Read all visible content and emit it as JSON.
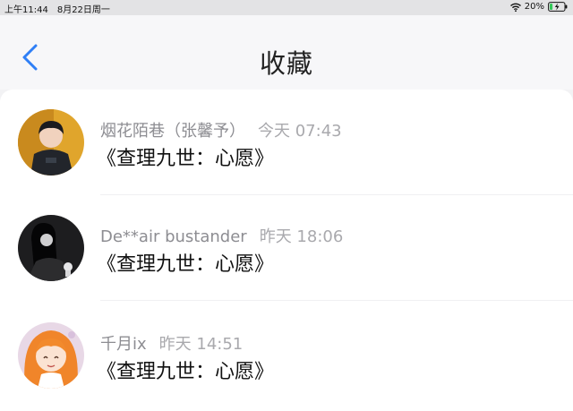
{
  "status_bar": {
    "time": "上午11:44",
    "date": "8月22日周一",
    "battery": "20%"
  },
  "header": {
    "title": "收藏",
    "back_icon": "chevron-left-icon"
  },
  "items": [
    {
      "author": "烟花陌巷（张馨予）",
      "time": "今天 07:43",
      "title": "《查理九世：心愿》"
    },
    {
      "author": "De**air bustander",
      "time": "昨天 18:06",
      "title": "《查理九世：心愿》"
    },
    {
      "author": "千月ix",
      "time": "昨天 14:51",
      "title": "《查理九世：心愿》"
    }
  ],
  "colors": {
    "accent": "#2f7ff6",
    "battery_charging": "#34c759"
  }
}
